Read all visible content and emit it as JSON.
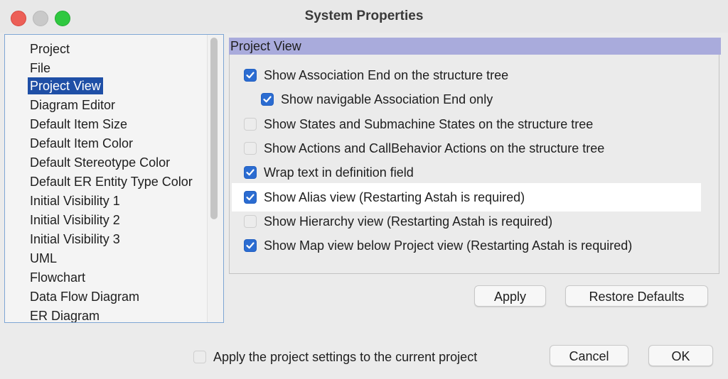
{
  "window": {
    "title": "System Properties"
  },
  "sidebar": {
    "items": [
      {
        "label": "Project",
        "selected": false
      },
      {
        "label": "File",
        "selected": false
      },
      {
        "label": "Project View",
        "selected": true
      },
      {
        "label": "Diagram Editor",
        "selected": false
      },
      {
        "label": "Default Item Size",
        "selected": false
      },
      {
        "label": "Default Item Color",
        "selected": false
      },
      {
        "label": "Default Stereotype Color",
        "selected": false
      },
      {
        "label": "Default ER Entity Type Color",
        "selected": false
      },
      {
        "label": "Initial Visibility 1",
        "selected": false
      },
      {
        "label": "Initial Visibility 2",
        "selected": false
      },
      {
        "label": "Initial Visibility 3",
        "selected": false
      },
      {
        "label": "UML",
        "selected": false
      },
      {
        "label": "Flowchart",
        "selected": false
      },
      {
        "label": "Data Flow Diagram",
        "selected": false
      },
      {
        "label": "ER Diagram",
        "selected": false
      }
    ]
  },
  "section": {
    "header": "Project View",
    "options": [
      {
        "label": "Show Association End on the structure tree",
        "checked": true
      },
      {
        "label": "Show navigable Association End only",
        "checked": true
      },
      {
        "label": "Show States and Submachine States on the structure tree",
        "checked": false
      },
      {
        "label": "Show Actions and CallBehavior Actions on the structure tree",
        "checked": false
      },
      {
        "label": "Wrap text in definition field",
        "checked": true
      },
      {
        "label": "Show Alias view (Restarting Astah is required)",
        "checked": true
      },
      {
        "label": "Show Hierarchy view (Restarting Astah is required)",
        "checked": false
      },
      {
        "label": "Show Map view below Project view (Restarting Astah is required)",
        "checked": true
      }
    ]
  },
  "buttons": {
    "apply": "Apply",
    "restore_defaults": "Restore Defaults",
    "cancel": "Cancel",
    "ok": "OK"
  },
  "footer": {
    "apply_project_settings": {
      "label": "Apply the project settings to the current project",
      "checked": false
    }
  },
  "colors": {
    "accent": "#2b6cd1",
    "selection": "#1f4fa6",
    "section_header": "#a9abdc"
  }
}
